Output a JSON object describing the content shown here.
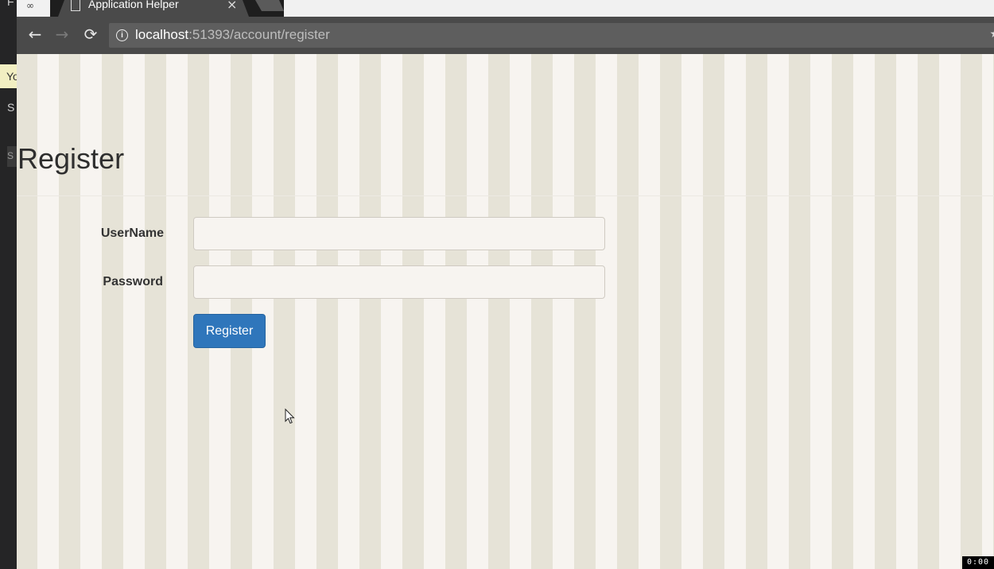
{
  "ide": {
    "line1": "F",
    "hint": "Yo",
    "line2": "S",
    "line3": "S"
  },
  "browser": {
    "tab": {
      "title": "Application Helper",
      "close_glyph": "×",
      "left_glyph": "∞"
    },
    "toolbar": {
      "back_glyph": "←",
      "forward_glyph": "→",
      "reload_glyph": "⟳",
      "info_glyph": "i",
      "url_host": "localhost",
      "url_rest": ":51393/account/register",
      "star_glyph": "★"
    }
  },
  "page": {
    "title": "Register",
    "form": {
      "username_label": "UserName",
      "username_value": "",
      "password_label": "Password",
      "password_value": "",
      "submit_label": "Register"
    }
  },
  "recording": {
    "timer": "0:00"
  },
  "colors": {
    "stripe_dark": "#e6e3d7",
    "stripe_light": "#f7f4f0",
    "button": "#2f76bb",
    "toolbar": "#4a4a4a"
  },
  "icons": [
    "back-arrow-icon",
    "forward-arrow-icon",
    "reload-icon",
    "info-icon",
    "bookmark-star-icon",
    "file-icon",
    "close-icon",
    "mouse-cursor-icon"
  ]
}
